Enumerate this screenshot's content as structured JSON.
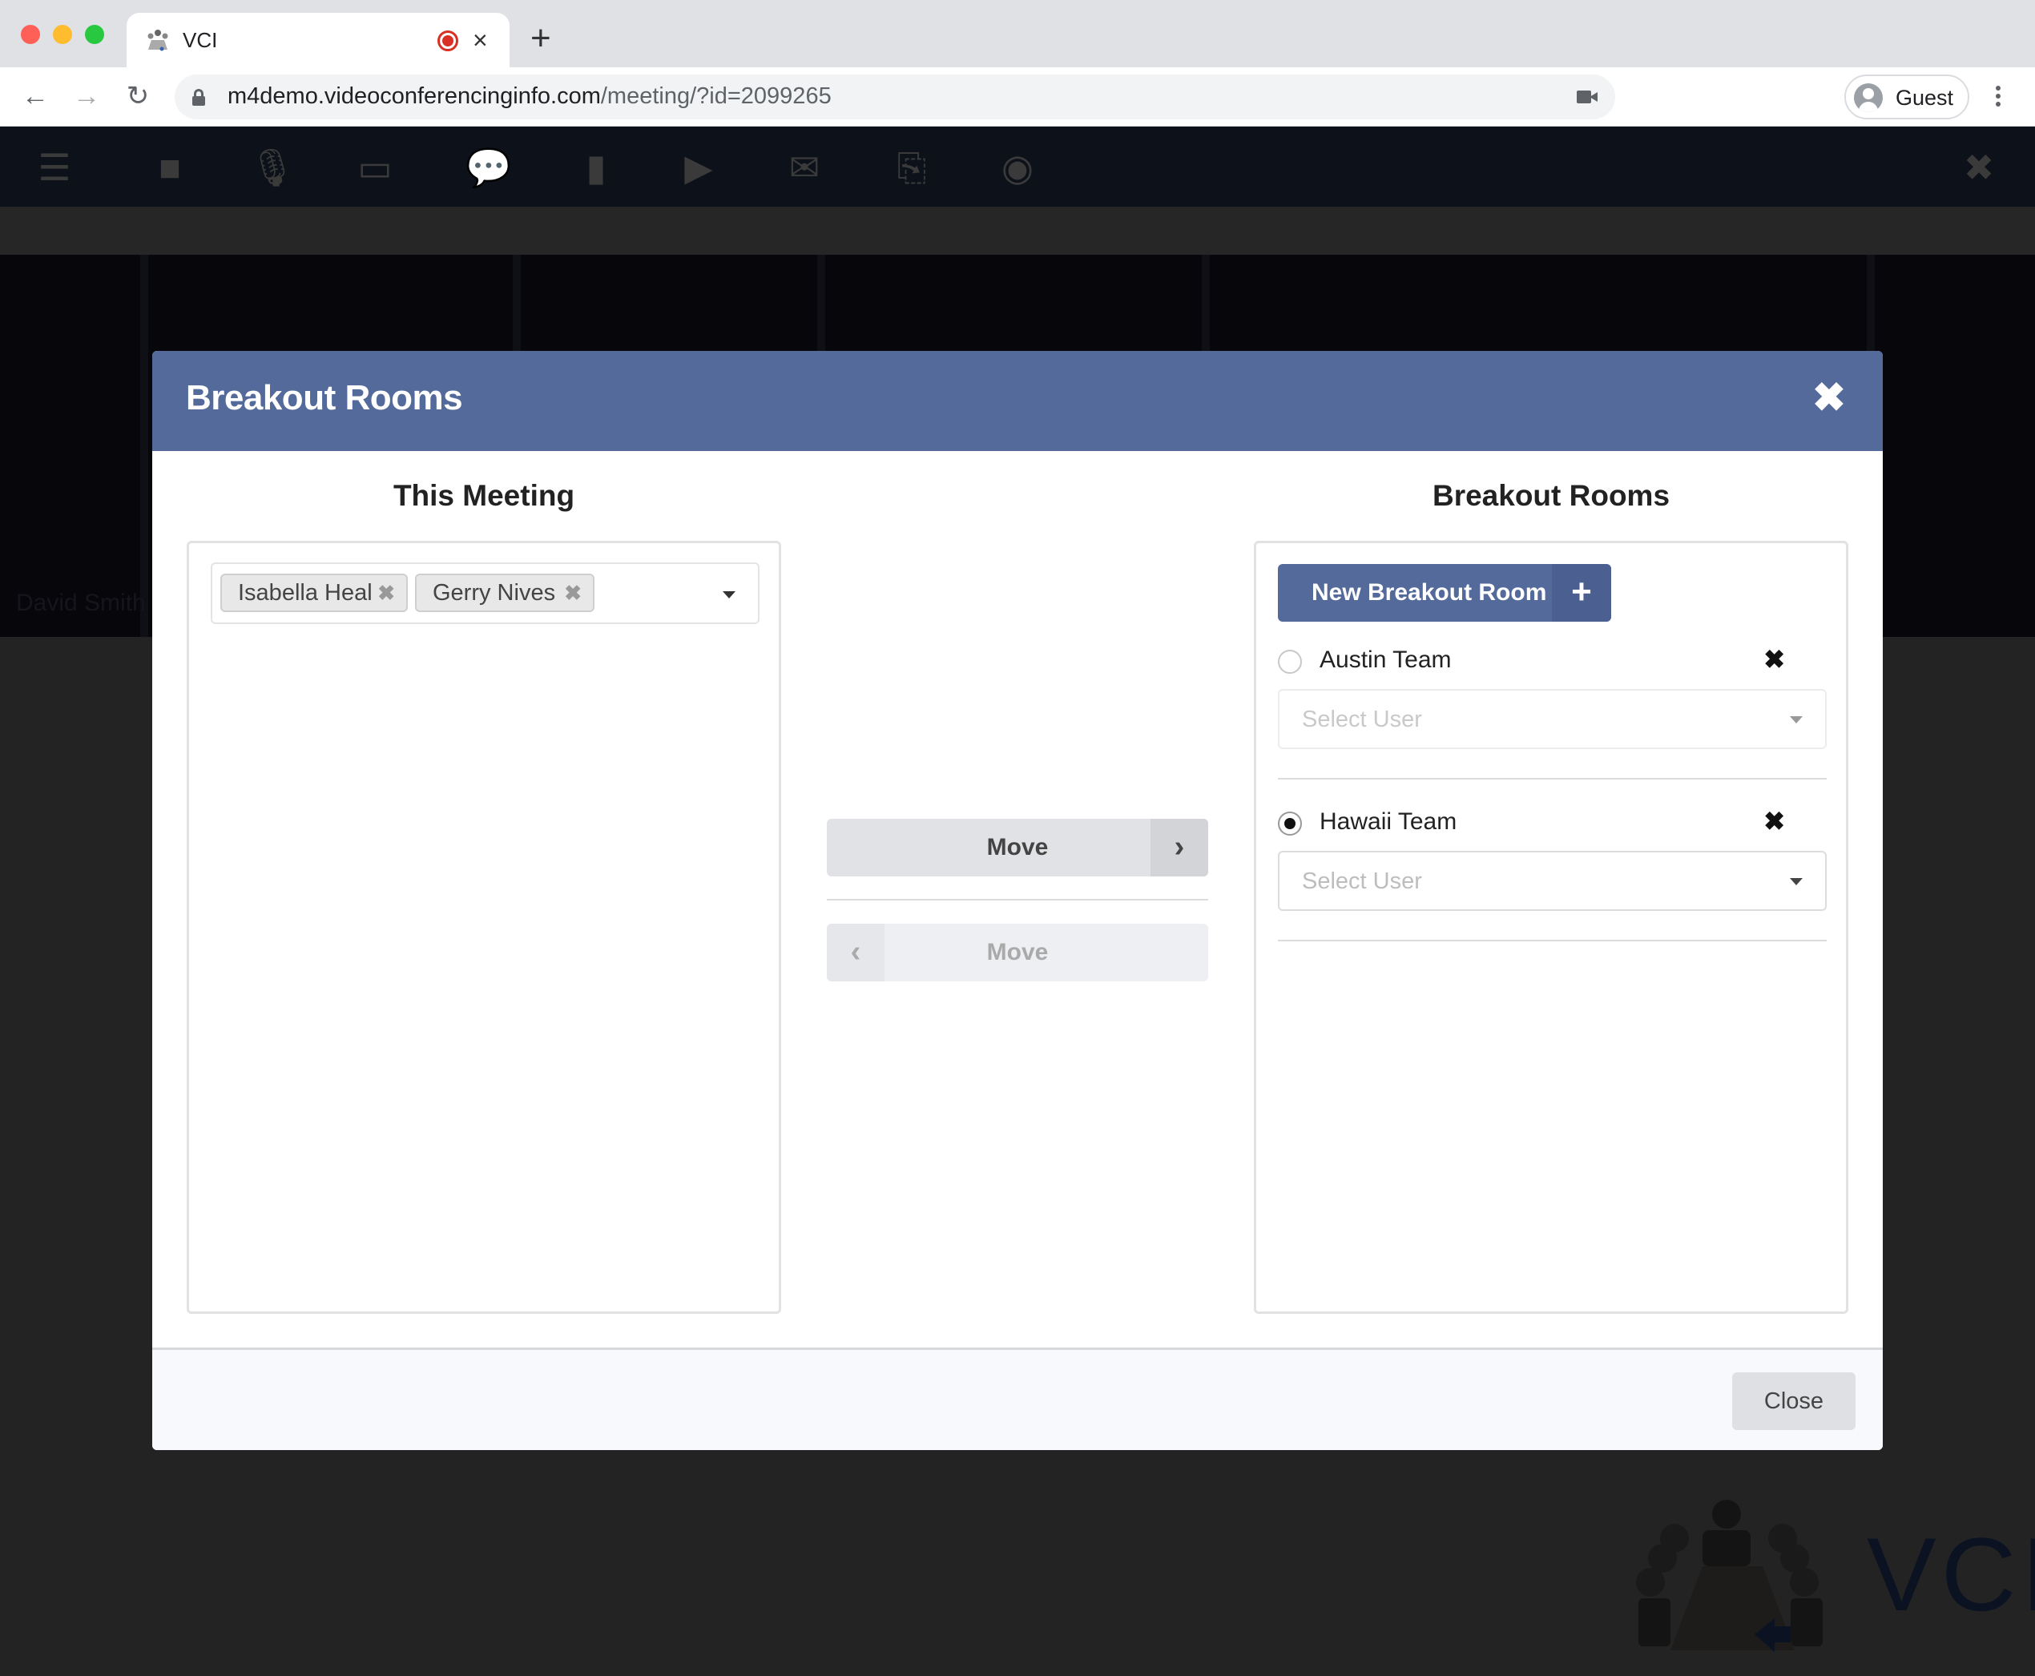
{
  "browser": {
    "tab_title": "VCI",
    "tab_close": "×",
    "new_tab": "+",
    "url_host": "m4demo.videoconferencinginfo.com",
    "url_path": "/meeting/?id=2099265",
    "profile_name": "Guest",
    "nav": {
      "back": "←",
      "forward": "→",
      "reload": "↻"
    }
  },
  "app_toolbar": {
    "icons": [
      {
        "name": "menu-icon",
        "glyph": "☰"
      },
      {
        "name": "video-camera-icon",
        "glyph": "■"
      },
      {
        "name": "microphone-muted-icon",
        "glyph": "🎙"
      },
      {
        "name": "screen-share-icon",
        "glyph": "▭"
      },
      {
        "name": "chat-icon",
        "glyph": "💬"
      },
      {
        "name": "document-icon",
        "glyph": "▮"
      },
      {
        "name": "media-play-icon",
        "glyph": "▶"
      },
      {
        "name": "envelope-icon",
        "glyph": "✉"
      },
      {
        "name": "exit-door-icon",
        "glyph": "⎘"
      },
      {
        "name": "record-icon",
        "glyph": "◉"
      }
    ],
    "close_glyph": "✖"
  },
  "video": {
    "participant_label": "David Smith"
  },
  "logo": {
    "text": "VCI"
  },
  "modal": {
    "title": "Breakout Rooms",
    "close_glyph": "✖",
    "left_column": {
      "title": "This Meeting",
      "selected_users": [
        {
          "name": "Isabella Heal",
          "remove_glyph": "✖"
        },
        {
          "name": "Gerry Nives",
          "remove_glyph": "✖"
        }
      ]
    },
    "middle": {
      "move_right": {
        "label": "Move",
        "arrow": "›",
        "enabled": true
      },
      "move_left": {
        "label": "Move",
        "arrow": "‹",
        "enabled": false
      }
    },
    "right_column": {
      "title": "Breakout Rooms",
      "new_room_button": {
        "label": "New Breakout Room",
        "plus": "+"
      },
      "rooms": [
        {
          "name": "Austin Team",
          "selected": false,
          "delete_glyph": "✖",
          "user_select_placeholder": "Select User",
          "enabled": false
        },
        {
          "name": "Hawaii Team",
          "selected": true,
          "delete_glyph": "✖",
          "user_select_placeholder": "Select User",
          "enabled": true
        }
      ]
    },
    "footer": {
      "close_label": "Close"
    }
  },
  "colors": {
    "modal_header": "#536a9a",
    "primary_button": "#536a9a",
    "app_toolbar_bg": "#0c111a"
  }
}
